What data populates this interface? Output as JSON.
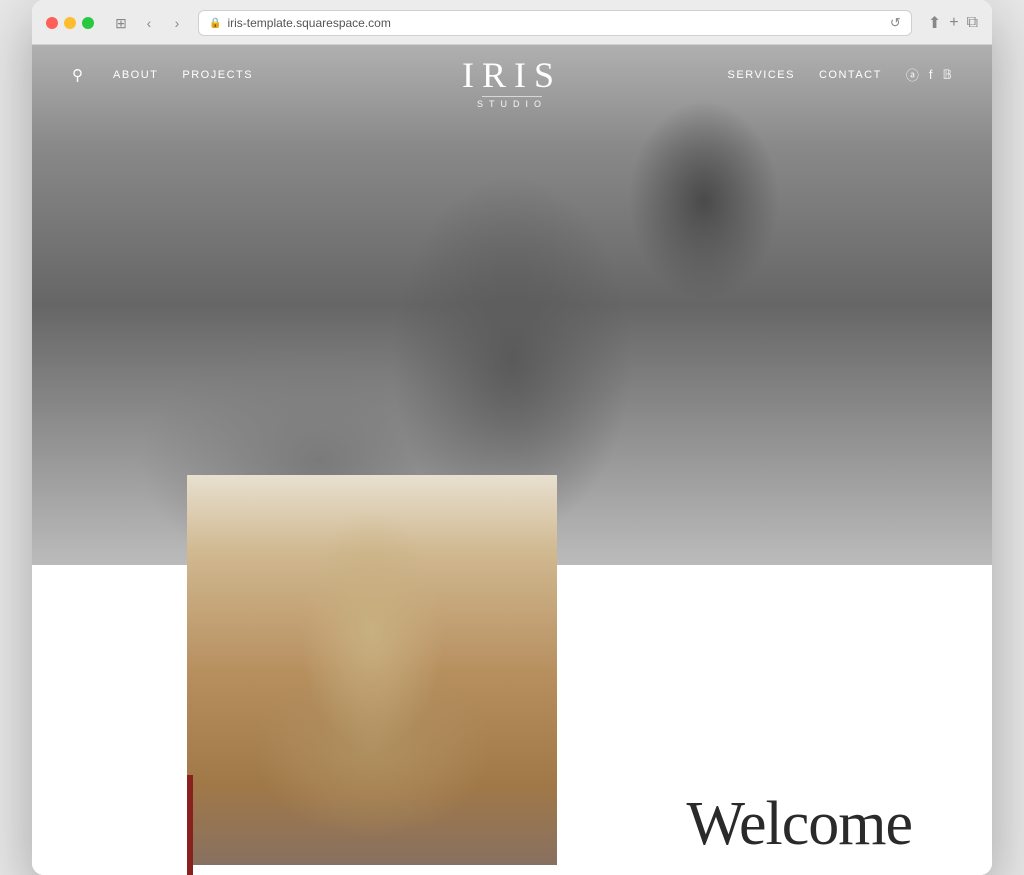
{
  "browser": {
    "url": "iris-template.squarespace.com",
    "traffic_lights": [
      "red",
      "yellow",
      "green"
    ]
  },
  "nav": {
    "logo_main": "IRIS",
    "logo_sub": "STUDIO",
    "links_left": [
      {
        "label": "ABOUT",
        "id": "about"
      },
      {
        "label": "PROJECTS",
        "id": "projects"
      }
    ],
    "links_right": [
      {
        "label": "SERVICES",
        "id": "services"
      },
      {
        "label": "CONTACT",
        "id": "contact"
      }
    ],
    "social": [
      {
        "label": "Instagram",
        "icon": "IG"
      },
      {
        "label": "Facebook",
        "icon": "f"
      },
      {
        "label": "Pinterest",
        "icon": "P"
      }
    ]
  },
  "hero": {
    "alt": "Black and white photo of woman in knit sweater"
  },
  "bottom": {
    "welcome_text": "Welcome",
    "image_alt": "Woman in tan cardigan with floral details"
  }
}
